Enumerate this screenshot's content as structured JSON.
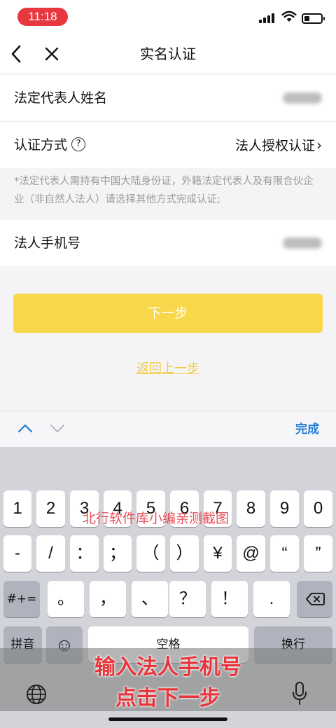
{
  "status": {
    "time": "11:18",
    "colors": {
      "time_pill": "#e8383f"
    }
  },
  "nav": {
    "title": "实名认证",
    "back_icon": "chevron-left-icon",
    "close_icon": "close-icon"
  },
  "form": {
    "legal_rep_name_label": "法定代表人姓名",
    "auth_method_label": "认证方式",
    "auth_method_value": "法人授权认证",
    "note": "*法定代表人需持有中国大陆身份证，外籍法定代表人及有限合伙企业（非自然人法人）请选择其他方式完成认证;",
    "phone_label": "法人手机号"
  },
  "actions": {
    "next": "下一步",
    "back": "返回上一步",
    "next_color": "#f8d74a"
  },
  "accessory": {
    "done": "完成"
  },
  "keyboard": {
    "row1": [
      "1",
      "2",
      "3",
      "4",
      "5",
      "6",
      "7",
      "8",
      "9",
      "0"
    ],
    "row2": [
      "-",
      "/",
      "：",
      "；",
      "（",
      "）",
      "¥",
      "@",
      "“",
      "”"
    ],
    "row3_left": "#+=",
    "row3": [
      "。",
      "，",
      "、",
      "？",
      "！",
      "."
    ],
    "pinyin": "拼音",
    "space": "空格",
    "return": "换行"
  },
  "overlay": {
    "watermark": "北行软件库小编亲测截图",
    "caption_line1": "输入法人手机号",
    "caption_line2": "点击下一步"
  }
}
